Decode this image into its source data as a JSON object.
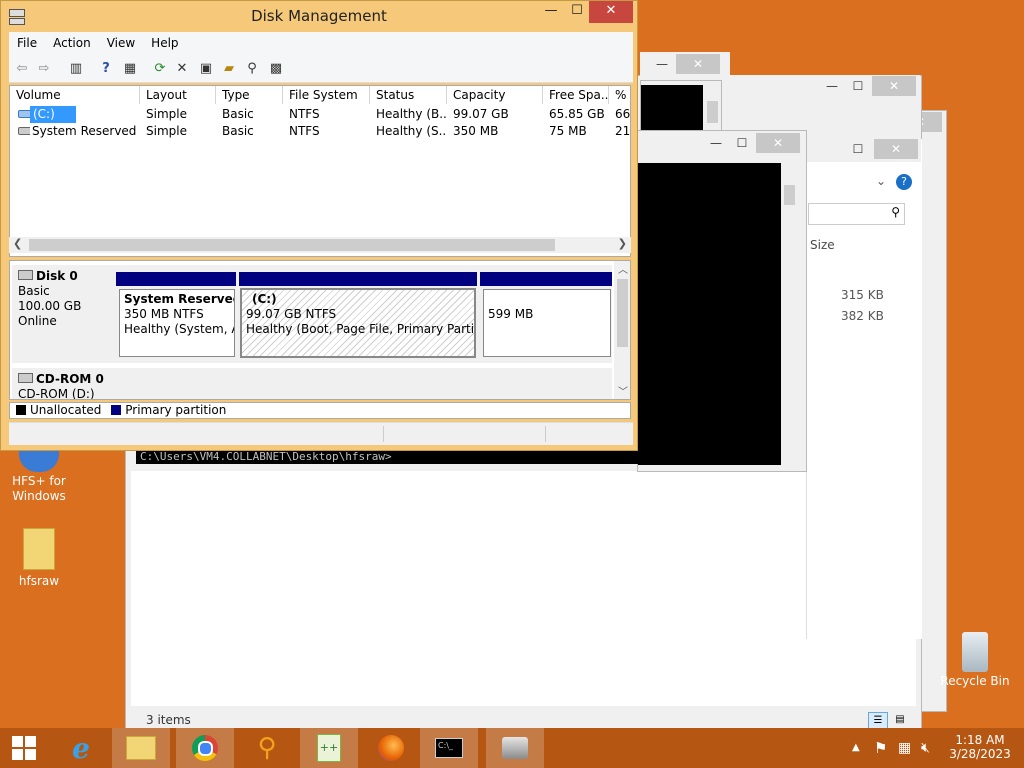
{
  "dm": {
    "title": "Disk Management",
    "controls": {
      "minimize": "—",
      "maximize": "☐",
      "close": "✕"
    },
    "menu": [
      "File",
      "Action",
      "View",
      "Help"
    ],
    "columns": [
      "Volume",
      "Layout",
      "Type",
      "File System",
      "Status",
      "Capacity",
      "Free Spa...",
      "% F"
    ],
    "rows": [
      [
        "(C:)",
        "Simple",
        "Basic",
        "NTFS",
        "Healthy (B...",
        "99.07 GB",
        "65.85 GB",
        "66"
      ],
      [
        "System Reserved",
        "Simple",
        "Basic",
        "NTFS",
        "Healthy (S...",
        "350 MB",
        "75 MB",
        "21"
      ]
    ],
    "disk0": {
      "name": "Disk 0",
      "type": "Basic",
      "size": "100.00 GB",
      "state": "Online",
      "parts": [
        {
          "name": "System Reserved",
          "size": "350 MB NTFS",
          "status": "Healthy (System, Ac"
        },
        {
          "name": "(C:)",
          "size": "99.07 GB NTFS",
          "status": "Healthy (Boot, Page File, Primary Partition)"
        },
        {
          "size": "599 MB"
        }
      ]
    },
    "cdrom": {
      "name": "CD-ROM 0",
      "sub": "CD-ROM (D:)"
    },
    "legend": {
      "unallocated": "Unallocated",
      "primary": "Primary partition"
    }
  },
  "console": {
    "prompt": "C:\\Users\\VM4.COLLABNET\\Desktop\\hfsraw>"
  },
  "explorer": {
    "col_size": "Size",
    "sizes": [
      "315 KB",
      "382 KB"
    ],
    "items_count": "3 items"
  },
  "desktop": {
    "icons": [
      {
        "label": "HFS+ for Windows"
      },
      {
        "label": "hfsraw"
      },
      {
        "label": "Recycle Bin"
      }
    ]
  },
  "taskbar": {
    "time": "1:18 AM",
    "date": "3/28/2023"
  },
  "colors": {
    "desktop": "#d96f1f",
    "taskbar": "#b55712",
    "primary_partition": "#000080",
    "titlebar": "#f5c979"
  }
}
